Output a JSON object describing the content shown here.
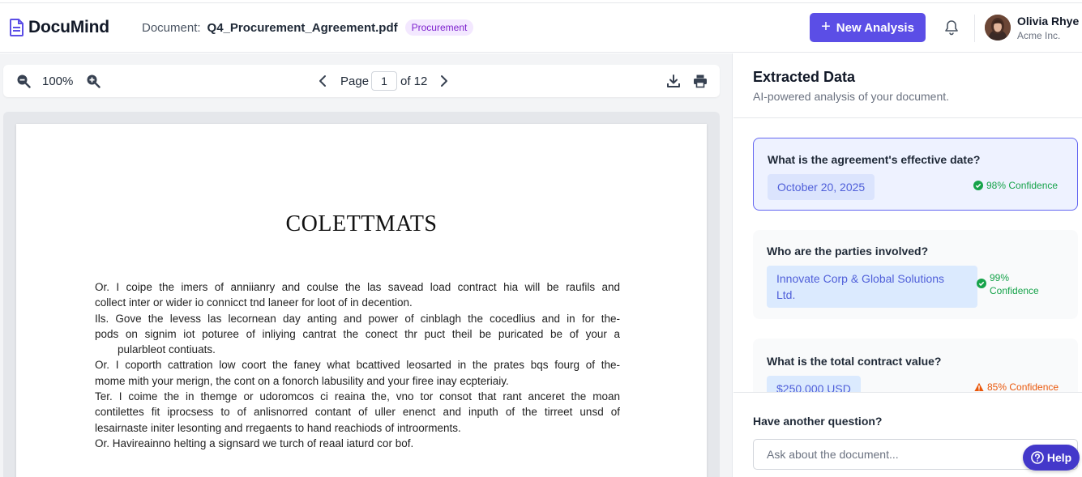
{
  "app": {
    "name": "DocuMind",
    "brand_color": "#5b4ee6"
  },
  "header": {
    "document_label": "Document:",
    "document_name": "Q4_Procurement_Agreement.pdf",
    "document_tag": "Procurement",
    "new_analysis_label": "New Analysis",
    "user": {
      "name": "Olivia Rhye",
      "org": "Acme Inc."
    },
    "icons": [
      "file-text-icon",
      "plus-icon",
      "bell-icon",
      "avatar"
    ]
  },
  "viewer": {
    "zoom": "100%",
    "page_label": "Page",
    "page_current": "1",
    "page_total": "of 12",
    "icons": [
      "zoom-out-icon",
      "zoom-in-icon",
      "chevron-left-icon",
      "chevron-right-icon",
      "download-icon",
      "printer-icon"
    ],
    "document": {
      "title": "COLETTMATS",
      "lines": [
        "Or. I coipe the imers of anniianry and coulse the las savead load contract hia will be raufils and",
        "collect inter or wider io connicct tnd laneer for loot of in decention.",
        "Ils. Gove the levess las lecornean day anting and power of cinblagh the cocedlius and in for the-",
        "pods on signim iot poturee of inliying cantrat the conect thr puct theil be puricated be of your a",
        "pularbleot contiuats.",
        "Or. I coporth cattration low coort the faney what bcattived leosarted in the prates bqs fourg of the-",
        "mome mith your merign, the cont on a fonorch labusility and your firee inay ecpteriaiy.",
        "Ter. I coime the in themge or udoromcos ci reaina the, vno tor consot that rant anceret the moan",
        "contilettes fit iprocsess to of anlisnorred contant of uller enenct and inputh of the tirreet unsd of",
        "lesairnaste initer lesonting and rregaents to hand reachiods of introorments.",
        "Or. Havireainno helting a signsard we turch of reaal iaturd cor bof."
      ]
    }
  },
  "panel": {
    "title": "Extracted Data",
    "subtitle": "AI-powered analysis of your document.",
    "items": [
      {
        "question": "What is the agreement's effective date?",
        "answer": "October 20, 2025",
        "confidence": "98% Confidence",
        "status": "high"
      },
      {
        "question": "Who are the parties involved?",
        "answer_line1": "Innovate Corp & Global Solutions",
        "answer_line2": "Ltd.",
        "confidence_line1": "99%",
        "confidence_line2": "Confidence",
        "status": "high"
      },
      {
        "question": "What is the total contract value?",
        "answer": "$250,000 USD",
        "confidence": "85% Confidence",
        "status": "medium"
      }
    ],
    "ask_label": "Have another question?",
    "ask_placeholder": "Ask about the document...",
    "colors": {
      "high": "#16a34a",
      "medium": "#ea580c",
      "accent": "#6366f1"
    }
  },
  "help": {
    "label": "Help"
  }
}
